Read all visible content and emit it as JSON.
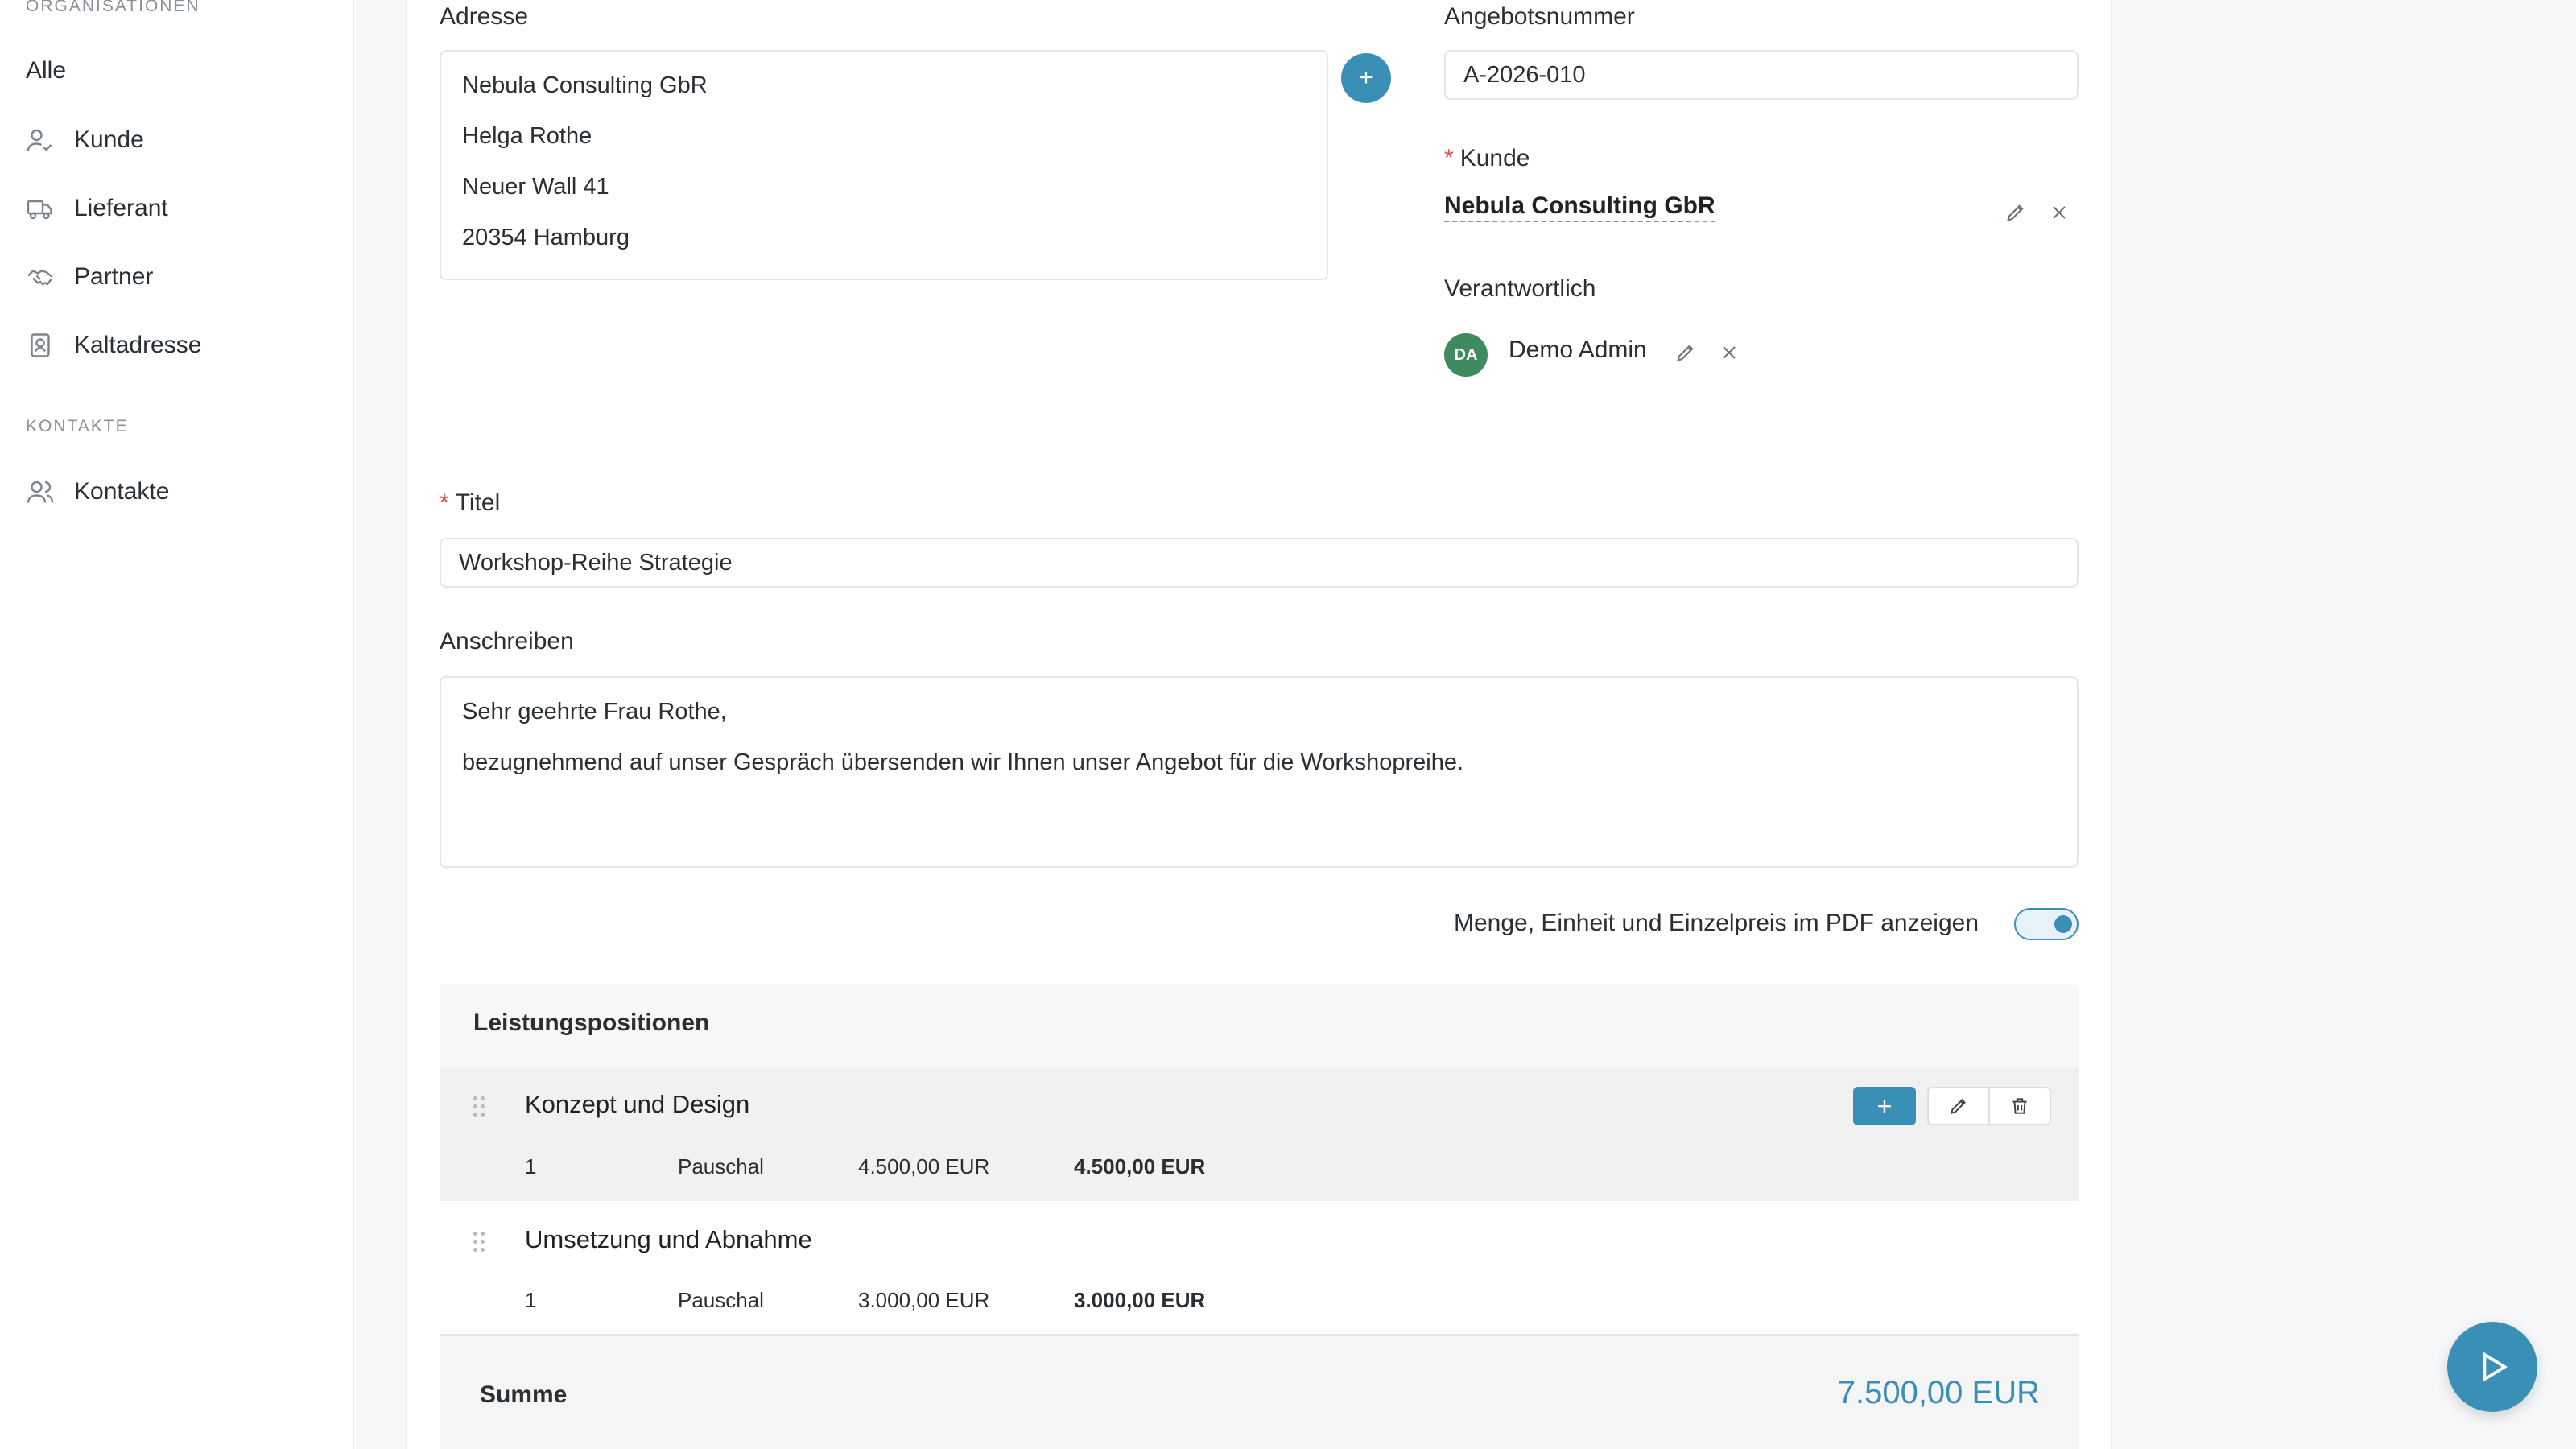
{
  "sidebar": {
    "section_organisations": "ORGANISATIONEN",
    "all_label": "Alle",
    "items": [
      {
        "label": "Kunde",
        "icon": "user-check-icon"
      },
      {
        "label": "Lieferant",
        "icon": "truck-icon"
      },
      {
        "label": "Partner",
        "icon": "handshake-icon"
      },
      {
        "label": "Kaltadresse",
        "icon": "contact-card-icon"
      }
    ],
    "section_contacts": "KONTAKTE",
    "contacts_item": {
      "label": "Kontakte",
      "icon": "users-icon"
    }
  },
  "form": {
    "address_label": "Adresse",
    "address_lines": [
      "Nebula Consulting GbR",
      "Helga Rothe",
      "Neuer Wall 41",
      "20354 Hamburg"
    ],
    "add_address_symbol": "+",
    "offer_number_label": "Angebotsnummer",
    "offer_number_value": "A-2026-010",
    "customer_required": "*",
    "customer_label": "Kunde",
    "customer_value": "Nebula Consulting GbR",
    "responsible_label": "Verantwortlich",
    "responsible_initials": "DA",
    "responsible_name": "Demo Admin",
    "title_required": "*",
    "title_label": "Titel",
    "title_value": "Workshop-Reihe Strategie",
    "letter_label": "Anschreiben",
    "letter_lines": [
      "Sehr geehrte Frau Rothe,",
      "bezugnehmend auf unser Gespräch übersenden wir Ihnen unser Angebot für die Workshopreihe."
    ],
    "toggle_label": "Menge, Einheit und Einzelpreis im PDF anzeigen",
    "toggle_on": true
  },
  "positions": {
    "heading": "Leistungspositionen",
    "add_symbol": "+",
    "items": [
      {
        "title": "Konzept und Design",
        "qty": "1",
        "unit": "Pauschal",
        "unit_price": "4.500,00 EUR",
        "total": "4.500,00 EUR"
      },
      {
        "title": "Umsetzung und Abnahme",
        "qty": "1",
        "unit": "Pauschal",
        "unit_price": "3.000,00 EUR",
        "total": "3.000,00 EUR"
      }
    ],
    "sum_label": "Summe",
    "sum_value": "7.500,00 EUR"
  },
  "colors": {
    "accent": "#3a8fb7",
    "required": "#e0504a",
    "avatar": "#3f8a5f"
  }
}
